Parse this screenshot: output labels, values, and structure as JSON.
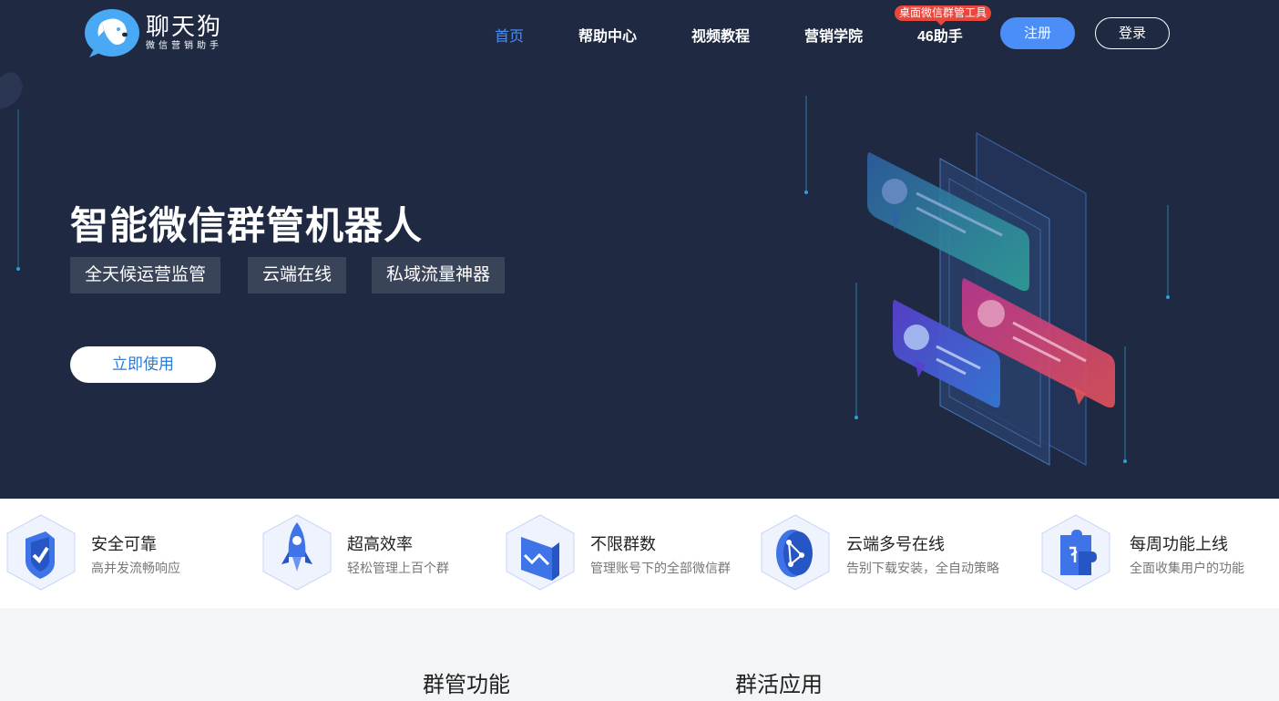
{
  "logo": {
    "name": "聊天狗",
    "tagline": "微信营销助手"
  },
  "nav": {
    "items": [
      {
        "label": "首页"
      },
      {
        "label": "帮助中心"
      },
      {
        "label": "视频教程"
      },
      {
        "label": "营销学院"
      },
      {
        "label": "46助手"
      }
    ],
    "badge": "桌面微信群管工具",
    "register": "注册",
    "login": "登录"
  },
  "hero": {
    "title": "智能微信群管机器人",
    "tags": [
      "全天候运营监管",
      "云端在线",
      "私域流量神器"
    ],
    "cta": "立即使用"
  },
  "features": [
    {
      "title": "安全可靠",
      "desc": "高并发流畅响应",
      "icon": "shield-check-icon"
    },
    {
      "title": "超高效率",
      "desc": "轻松管理上百个群",
      "icon": "rocket-icon"
    },
    {
      "title": "不限群数",
      "desc": "管理账号下的全部微信群",
      "icon": "book-chart-icon"
    },
    {
      "title": "云端多号在线",
      "desc": "告别下载安装，全自动策略",
      "icon": "network-icon"
    },
    {
      "title": "每周功能上线",
      "desc": "全面收集用户的功能",
      "icon": "puzzle-icon"
    }
  ],
  "section": {
    "tabs": [
      "群管功能",
      "群活应用"
    ]
  },
  "colors": {
    "hero_bg": "#1f2a42",
    "accent": "#4c8ef7",
    "badge": "#e9463e"
  }
}
